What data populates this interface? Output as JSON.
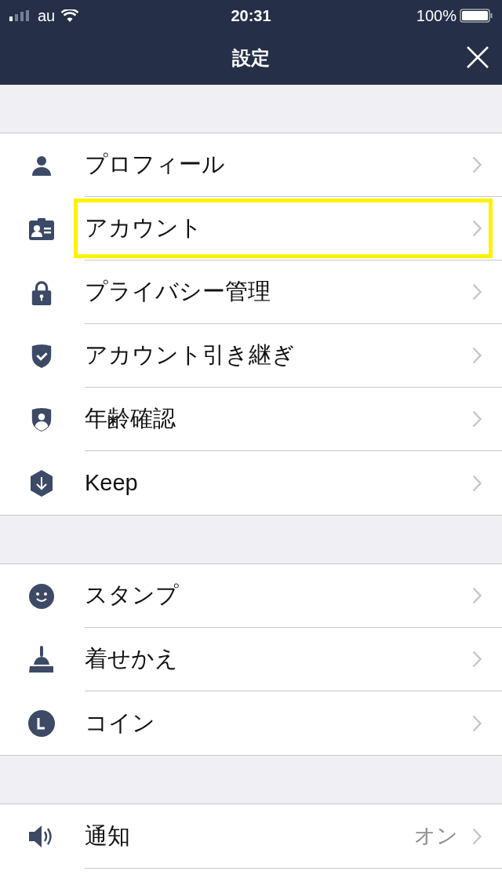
{
  "status_bar": {
    "carrier": "au",
    "time": "20:31",
    "battery": "100%"
  },
  "nav": {
    "title": "設定"
  },
  "sections": [
    {
      "items": [
        {
          "label": "プロフィール",
          "highlighted": false
        },
        {
          "label": "アカウント",
          "highlighted": true
        },
        {
          "label": "プライバシー管理",
          "highlighted": false
        },
        {
          "label": "アカウント引き継ぎ",
          "highlighted": false
        },
        {
          "label": "年齢確認",
          "highlighted": false
        },
        {
          "label": "Keep",
          "highlighted": false
        }
      ]
    },
    {
      "items": [
        {
          "label": "スタンプ",
          "highlighted": false
        },
        {
          "label": "着せかえ",
          "highlighted": false
        },
        {
          "label": "コイン",
          "highlighted": false
        }
      ]
    },
    {
      "items": [
        {
          "label": "通知",
          "value": "オン",
          "highlighted": false
        }
      ]
    }
  ]
}
